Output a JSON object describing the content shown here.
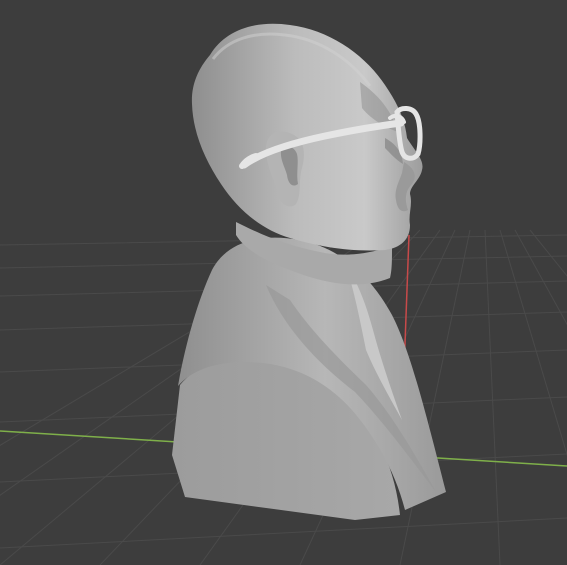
{
  "app": {
    "name": "3D Viewport"
  },
  "scene": {
    "subject": "bust-model",
    "background_color": "#3d3d3d",
    "grid_color": "#4a4a4a",
    "x_axis_color": "#7fb04a",
    "y_axis_color": "#c84a4a",
    "model_color": "#b3b3b3"
  }
}
